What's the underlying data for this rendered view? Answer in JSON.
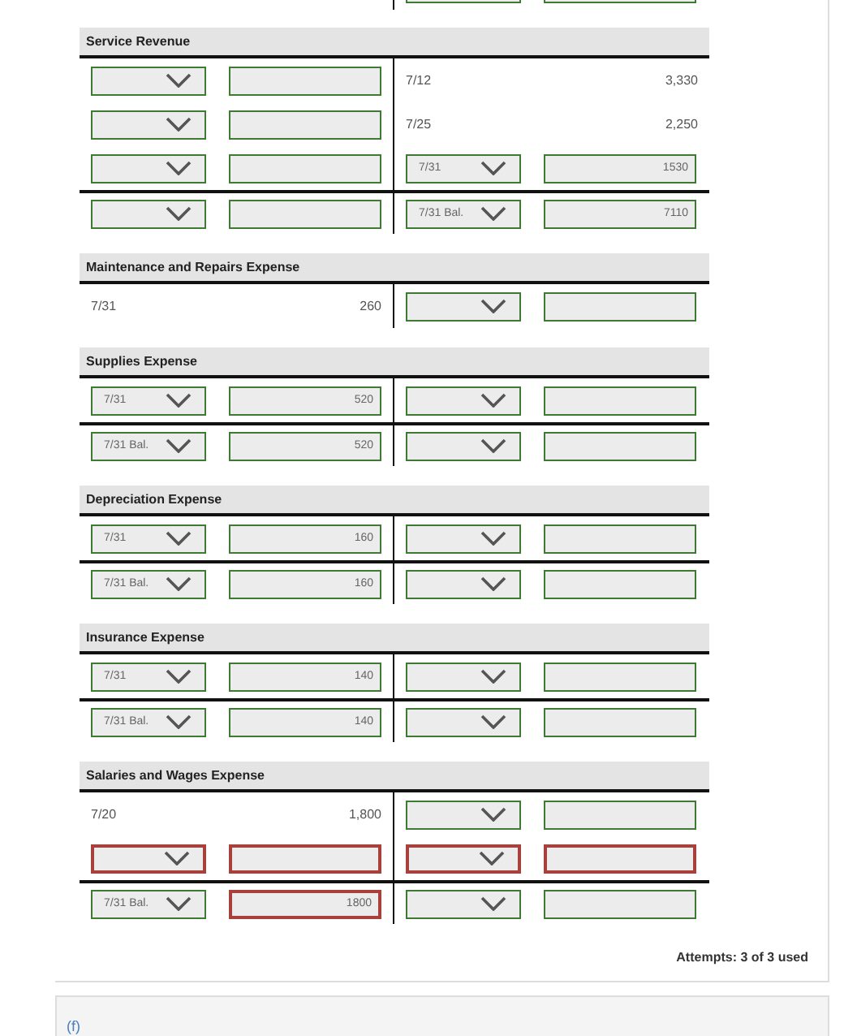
{
  "previous_account_fragment": {
    "right": {
      "kind": "input",
      "select": {
        "wrong": false
      },
      "field": {
        "wrong": false
      }
    }
  },
  "accounts": [
    {
      "title": "Service Revenue",
      "rows": [
        {
          "kind": "entry",
          "left": {
            "kind": "input",
            "select": {
              "wrong": false
            },
            "field": {
              "wrong": false
            }
          },
          "right": {
            "kind": "text",
            "date": "7/12",
            "amount": "3,330"
          }
        },
        {
          "kind": "entry",
          "left": {
            "kind": "input",
            "select": {
              "wrong": false
            },
            "field": {
              "wrong": false
            }
          },
          "right": {
            "kind": "text",
            "date": "7/25",
            "amount": "2,250"
          }
        },
        {
          "kind": "entry",
          "left": {
            "kind": "input",
            "select": {
              "wrong": false
            },
            "field": {
              "wrong": false
            }
          },
          "right": {
            "kind": "input",
            "select": {
              "value": "7/31",
              "wrong": false
            },
            "field": {
              "value": "1530",
              "wrong": false
            }
          }
        },
        {
          "kind": "balance",
          "left": {
            "kind": "input",
            "select": {
              "wrong": false
            },
            "field": {
              "wrong": false
            }
          },
          "right": {
            "kind": "input",
            "select": {
              "value": "7/31 Bal.",
              "wrong": false
            },
            "field": {
              "value": "7110",
              "wrong": false
            }
          }
        }
      ]
    },
    {
      "title": "Maintenance and Repairs Expense",
      "rows": [
        {
          "kind": "entry",
          "left": {
            "kind": "text",
            "date": "7/31",
            "amount": "260"
          },
          "right": {
            "kind": "input",
            "select": {
              "wrong": false
            },
            "field": {
              "wrong": false
            }
          }
        }
      ]
    },
    {
      "title": "Supplies Expense",
      "rows": [
        {
          "kind": "entry",
          "left": {
            "kind": "input",
            "select": {
              "value": "7/31",
              "wrong": false
            },
            "field": {
              "value": "520",
              "wrong": false
            }
          },
          "right": {
            "kind": "input",
            "select": {
              "wrong": false
            },
            "field": {
              "wrong": false
            }
          }
        },
        {
          "kind": "balance",
          "left": {
            "kind": "input",
            "select": {
              "value": "7/31 Bal.",
              "wrong": false
            },
            "field": {
              "value": "520",
              "wrong": false
            }
          },
          "right": {
            "kind": "input",
            "select": {
              "wrong": false
            },
            "field": {
              "wrong": false
            }
          }
        }
      ]
    },
    {
      "title": "Depreciation Expense",
      "rows": [
        {
          "kind": "entry",
          "left": {
            "kind": "input",
            "select": {
              "value": "7/31",
              "wrong": false
            },
            "field": {
              "value": "160",
              "wrong": false
            }
          },
          "right": {
            "kind": "input",
            "select": {
              "wrong": false
            },
            "field": {
              "wrong": false
            }
          }
        },
        {
          "kind": "balance",
          "left": {
            "kind": "input",
            "select": {
              "value": "7/31 Bal.",
              "wrong": false
            },
            "field": {
              "value": "160",
              "wrong": false
            }
          },
          "right": {
            "kind": "input",
            "select": {
              "wrong": false
            },
            "field": {
              "wrong": false
            }
          }
        }
      ]
    },
    {
      "title": "Insurance Expense",
      "rows": [
        {
          "kind": "entry",
          "left": {
            "kind": "input",
            "select": {
              "value": "7/31",
              "wrong": false
            },
            "field": {
              "value": "140",
              "wrong": false
            }
          },
          "right": {
            "kind": "input",
            "select": {
              "wrong": false
            },
            "field": {
              "wrong": false
            }
          }
        },
        {
          "kind": "balance",
          "left": {
            "kind": "input",
            "select": {
              "value": "7/31 Bal.",
              "wrong": false
            },
            "field": {
              "value": "140",
              "wrong": false
            }
          },
          "right": {
            "kind": "input",
            "select": {
              "wrong": false
            },
            "field": {
              "wrong": false
            }
          }
        }
      ]
    },
    {
      "title": "Salaries and Wages Expense",
      "rows": [
        {
          "kind": "entry",
          "left": {
            "kind": "text",
            "date": "7/20",
            "amount": "1,800"
          },
          "right": {
            "kind": "input",
            "select": {
              "wrong": false
            },
            "field": {
              "wrong": false
            }
          }
        },
        {
          "kind": "entry",
          "left": {
            "kind": "input",
            "select": {
              "wrong": true
            },
            "field": {
              "wrong": true
            }
          },
          "right": {
            "kind": "input",
            "select": {
              "wrong": true
            },
            "field": {
              "wrong": true
            }
          }
        },
        {
          "kind": "balance",
          "left": {
            "kind": "input",
            "select": {
              "value": "7/31 Bal.",
              "wrong": false
            },
            "field": {
              "value": "1800",
              "wrong": true
            }
          },
          "right": {
            "kind": "input",
            "select": {
              "wrong": false
            },
            "field": {
              "wrong": false
            }
          }
        }
      ]
    }
  ],
  "attempts": "Attempts: 3 of 3 used",
  "next_part": {
    "label": "(f)"
  }
}
